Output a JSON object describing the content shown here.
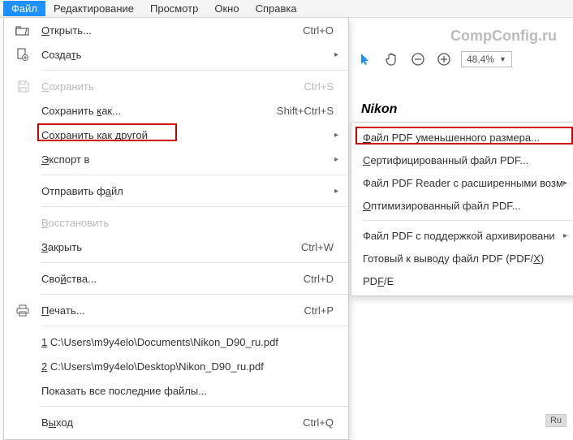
{
  "menubar": {
    "items": [
      "Файл",
      "Редактирование",
      "Просмотр",
      "Окно",
      "Справка"
    ],
    "active_index": 0
  },
  "watermark": "CompConfig.ru",
  "toolbar": {
    "zoom": "48,4%"
  },
  "document_title": "Nikon",
  "file_menu": {
    "open": {
      "label": "Открыть...",
      "shortcut": "Ctrl+O"
    },
    "create": {
      "label": "Создать"
    },
    "save": {
      "label": "Сохранить",
      "shortcut": "Ctrl+S"
    },
    "save_as": {
      "label": "Сохранить как...",
      "shortcut": "Shift+Ctrl+S"
    },
    "save_as_other": {
      "label": "Сохранить как другой"
    },
    "export": {
      "label": "Экспорт в"
    },
    "send": {
      "label": "Отправить файл"
    },
    "restore": {
      "label": "Восстановить"
    },
    "close": {
      "label": "Закрыть",
      "shortcut": "Ctrl+W"
    },
    "properties": {
      "label": "Свойства...",
      "shortcut": "Ctrl+D"
    },
    "print": {
      "label": "Печать...",
      "shortcut": "Ctrl+P"
    },
    "recent1": {
      "label": "1 C:\\Users\\m9y4elo\\Documents\\Nikon_D90_ru.pdf"
    },
    "recent2": {
      "label": "2 C:\\Users\\m9y4elo\\Desktop\\Nikon_D90_ru.pdf"
    },
    "show_all": {
      "label": "Показать все последние файлы..."
    },
    "exit": {
      "label": "Выход",
      "shortcut": "Ctrl+Q"
    }
  },
  "submenu": {
    "reduced": "Файл PDF уменьшенного размера...",
    "certified": "Сертифицированный файл PDF...",
    "reader": "Файл PDF Reader с расширенными возм",
    "optimized": "Оптимизированный файл PDF...",
    "archive": "Файл PDF с поддержкой архивировани",
    "print_ready": "Готовый к выводу файл PDF (PDF/X)",
    "pdfe": "PDF/E"
  },
  "badge": "Ru"
}
